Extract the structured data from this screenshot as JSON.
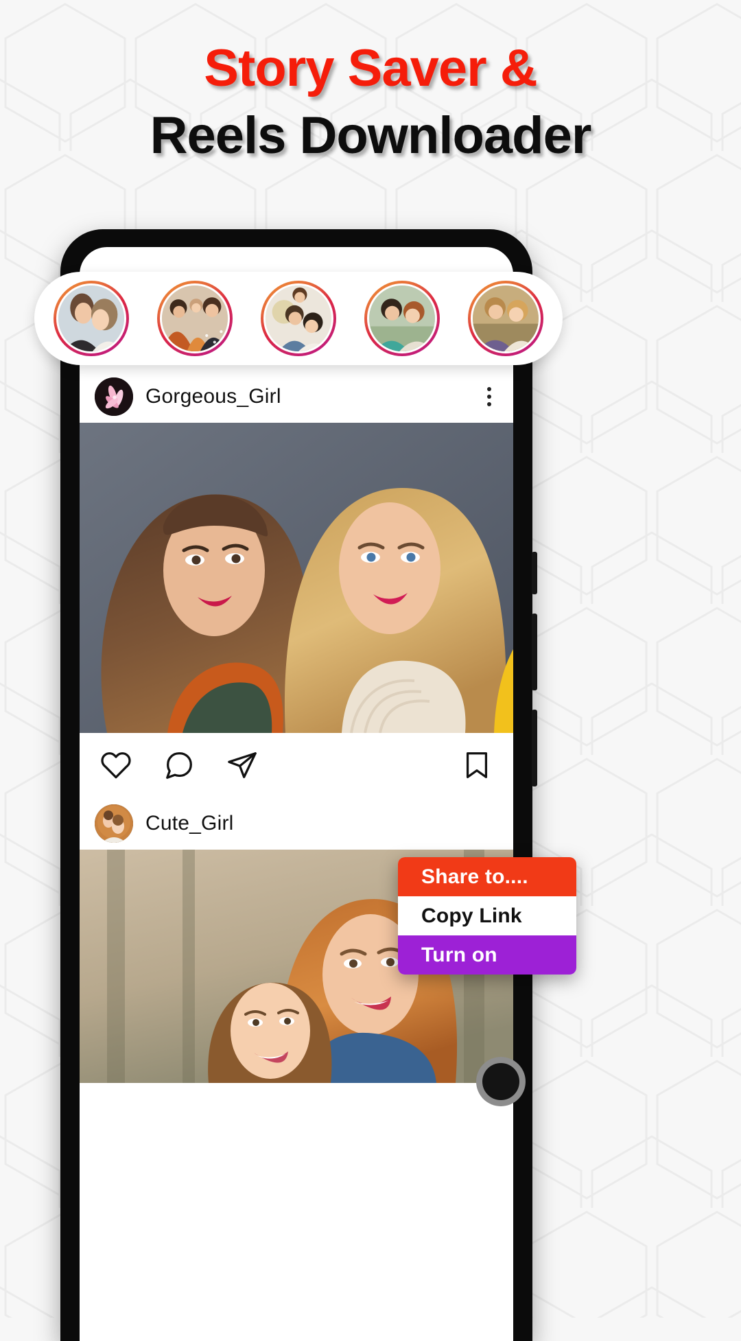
{
  "headline": {
    "line1": "Story Saver &",
    "line2": "Reels Downloader",
    "line1_color": "#f51d0a",
    "line2_color": "#0d0d0d"
  },
  "stories": {
    "ring_gradient": [
      "#f09433",
      "#e6683c",
      "#dc2743",
      "#cc2366",
      "#bc1888"
    ],
    "items": [
      {
        "name": "story-1"
      },
      {
        "name": "story-2"
      },
      {
        "name": "story-3"
      },
      {
        "name": "story-4"
      },
      {
        "name": "story-5"
      }
    ]
  },
  "feed": {
    "posts": [
      {
        "username": "Gorgeous_Girl",
        "more_icon": "kebab-menu-icon",
        "actions": {
          "like": "heart-icon",
          "comment": "comment-bubble-icon",
          "share": "send-paper-plane-icon",
          "save": "bookmark-icon"
        }
      },
      {
        "username": "Cute_Girl",
        "more_icon": "kebab-menu-icon"
      }
    ]
  },
  "popup": {
    "items": [
      {
        "label": "Share to....",
        "bg": "#f13a17",
        "color": "#ffffff"
      },
      {
        "label": "Copy Link",
        "bg": "#ffffff",
        "color": "#111111"
      },
      {
        "label": "Turn on",
        "bg": "#9d21d6",
        "color": "#ffffff"
      }
    ]
  }
}
